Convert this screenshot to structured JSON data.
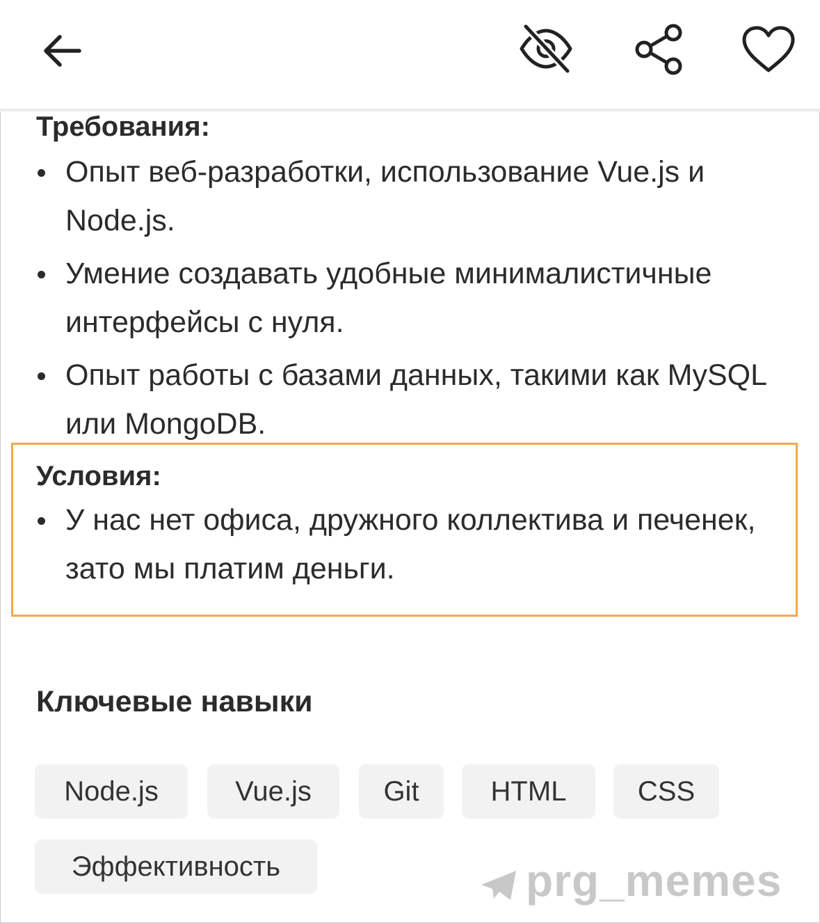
{
  "header": {
    "back_icon": "arrow-left-icon",
    "hide_icon": "eye-off-icon",
    "share_icon": "share-icon",
    "favorite_icon": "heart-icon"
  },
  "requirements": {
    "title": "Требования:",
    "items": [
      "Опыт веб-разработки, использование Vue.js и Node.js.",
      "Умение создавать удобные минималистичные интерфейсы с нуля.",
      "Опыт работы с базами данных, такими как MySQL или MongoDB."
    ]
  },
  "conditions": {
    "title": "Условия:",
    "items": [
      "У нас нет офиса, дружного коллектива и печенек, зато мы платим деньги."
    ],
    "highlight_color": "#f2a94b"
  },
  "skills": {
    "title": "Ключевые навыки",
    "chips": [
      "Node.js",
      "Vue.js",
      "Git",
      "HTML",
      "CSS",
      "Эффективность"
    ]
  },
  "watermark": {
    "text": "prg_memes",
    "icon": "telegram-icon"
  }
}
